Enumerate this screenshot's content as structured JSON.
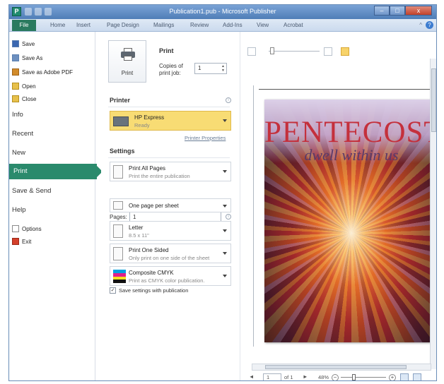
{
  "window": {
    "title": "Publication1.pub - Microsoft Publisher",
    "app_icon_letter": "P",
    "controls": {
      "minimize": "–",
      "maximize": "□",
      "close": "x"
    },
    "help_glyph": "?",
    "minimize_ribbon_glyph": "^"
  },
  "ribbon": {
    "file_tab": "File",
    "tabs": [
      "Home",
      "Insert",
      "Page Design",
      "Mailings",
      "Review",
      "Add-Ins",
      "View",
      "Acrobat"
    ]
  },
  "nav": {
    "commands": [
      {
        "label": "Save",
        "icon": "save-icon"
      },
      {
        "label": "Save As",
        "icon": "save-as-icon"
      },
      {
        "label": "Save as Adobe PDF",
        "icon": "pdf-icon"
      },
      {
        "label": "Open",
        "icon": "open-folder-icon"
      },
      {
        "label": "Close",
        "icon": "close-folder-icon"
      }
    ],
    "sections": [
      "Info",
      "Recent",
      "New"
    ],
    "active": "Print",
    "sections2": [
      "Save & Send",
      "Help"
    ],
    "bottom": [
      {
        "label": "Options",
        "icon": "options-icon"
      },
      {
        "label": "Exit",
        "icon": "exit-icon"
      }
    ]
  },
  "print": {
    "heading": "Print",
    "button_label": "Print",
    "copies_label": "Copies of print job:",
    "copies_value": "1",
    "printer_heading": "Printer",
    "printer_name": "HP Express",
    "printer_status": "Ready",
    "printer_properties": "Printer Properties",
    "settings_heading": "Settings",
    "pages_label": "Pages:",
    "pages_value": "1",
    "options": [
      {
        "l1": "Print All Pages",
        "l2": "Print the entire publication"
      },
      {
        "l1": "One page per sheet",
        "l2": ""
      },
      {
        "l1": "Letter",
        "l2": "8.5 x 11\""
      },
      {
        "l1": "Print One Sided",
        "l2": "Only print on one side of the sheet"
      },
      {
        "l1": "Composite CMYK",
        "l2": "Print as CMYK color publication."
      }
    ],
    "save_settings": "Save settings with publication",
    "save_settings_checked": true,
    "checkmark": "✓"
  },
  "preview": {
    "title_text": "PENTECOST",
    "subtitle_text": "dwell within us",
    "page_current": "1",
    "page_of": "of 1",
    "zoom": "48%",
    "zoom_minus": "−",
    "zoom_plus": "+",
    "nav_prev": "◄",
    "nav_next": "►"
  }
}
